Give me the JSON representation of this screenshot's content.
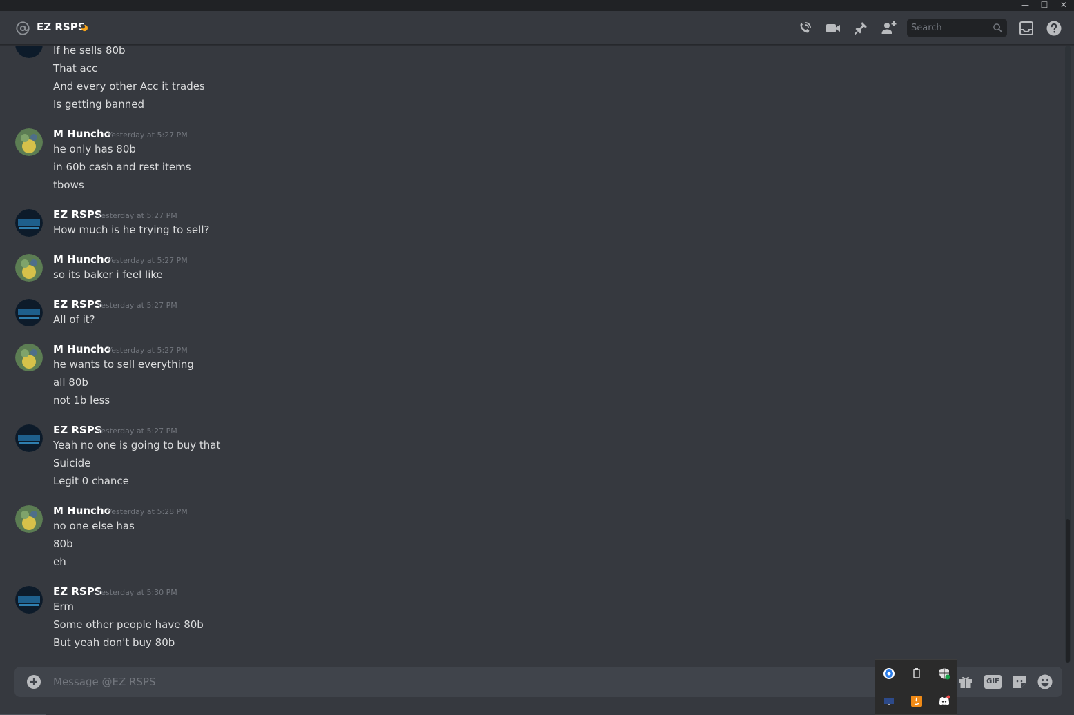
{
  "window": {
    "minimize_glyph": "—",
    "maximize_glyph": "☐",
    "close_glyph": "✕"
  },
  "header": {
    "channel_name": "EZ RSPS",
    "status": "idle",
    "search_placeholder": "Search",
    "icons": [
      "at-icon",
      "phone-call-icon",
      "video-call-icon",
      "pin-icon",
      "add-friend-icon",
      "search-icon",
      "inbox-icon",
      "help-icon"
    ]
  },
  "messages": [
    {
      "lines": [
        "If he sells 80b",
        "That acc",
        "And every other Acc it trades",
        "Is getting banned"
      ]
    },
    {
      "author": "M Huncho",
      "timestamp": "Yesterday at 5:27 PM",
      "lines": [
        "he only has 80b",
        "in 60b cash and rest items",
        "tbows"
      ]
    },
    {
      "author": "EZ RSPS",
      "timestamp": "Yesterday at 5:27 PM",
      "lines": [
        "How much is he trying to sell?"
      ]
    },
    {
      "author": "M Huncho",
      "timestamp": "Yesterday at 5:27 PM",
      "lines": [
        "so its baker i feel like"
      ]
    },
    {
      "author": "EZ RSPS",
      "timestamp": "Yesterday at 5:27 PM",
      "lines": [
        "All of it?"
      ]
    },
    {
      "author": "M Huncho",
      "timestamp": "Yesterday at 5:27 PM",
      "lines": [
        "he wants to sell everything",
        "all 80b",
        "not 1b less"
      ]
    },
    {
      "author": "EZ RSPS",
      "timestamp": "Yesterday at 5:27 PM",
      "lines": [
        "Yeah no one is going to buy that",
        "Suicide",
        "Legit 0 chance"
      ]
    },
    {
      "author": "M Huncho",
      "timestamp": "Yesterday at 5:28 PM",
      "lines": [
        "no one else has",
        "80b",
        "eh"
      ]
    },
    {
      "author": "EZ RSPS",
      "timestamp": "Yesterday at 5:30 PM",
      "lines": [
        "Erm",
        "Some other people have 80b",
        "But yeah don't buy 80b"
      ]
    }
  ],
  "composer": {
    "placeholder": "Message @EZ RSPS",
    "gif_label": "GIF",
    "icons": [
      "add-attachment-icon",
      "gift-icon",
      "gif-icon",
      "sticker-icon",
      "emoji-icon"
    ]
  },
  "tray": {
    "icons": [
      "browser-tray-icon",
      "usb-tray-icon",
      "defender-tray-icon",
      "display-tray-icon",
      "java-tray-icon",
      "discord-tray-icon"
    ]
  },
  "colors": {
    "background": "#36393f",
    "titlebar": "#202225",
    "composer": "#40444b",
    "author": "#ffffff",
    "text": "#dcddde",
    "timestamp": "#72767d",
    "idle": "#faa61a"
  }
}
